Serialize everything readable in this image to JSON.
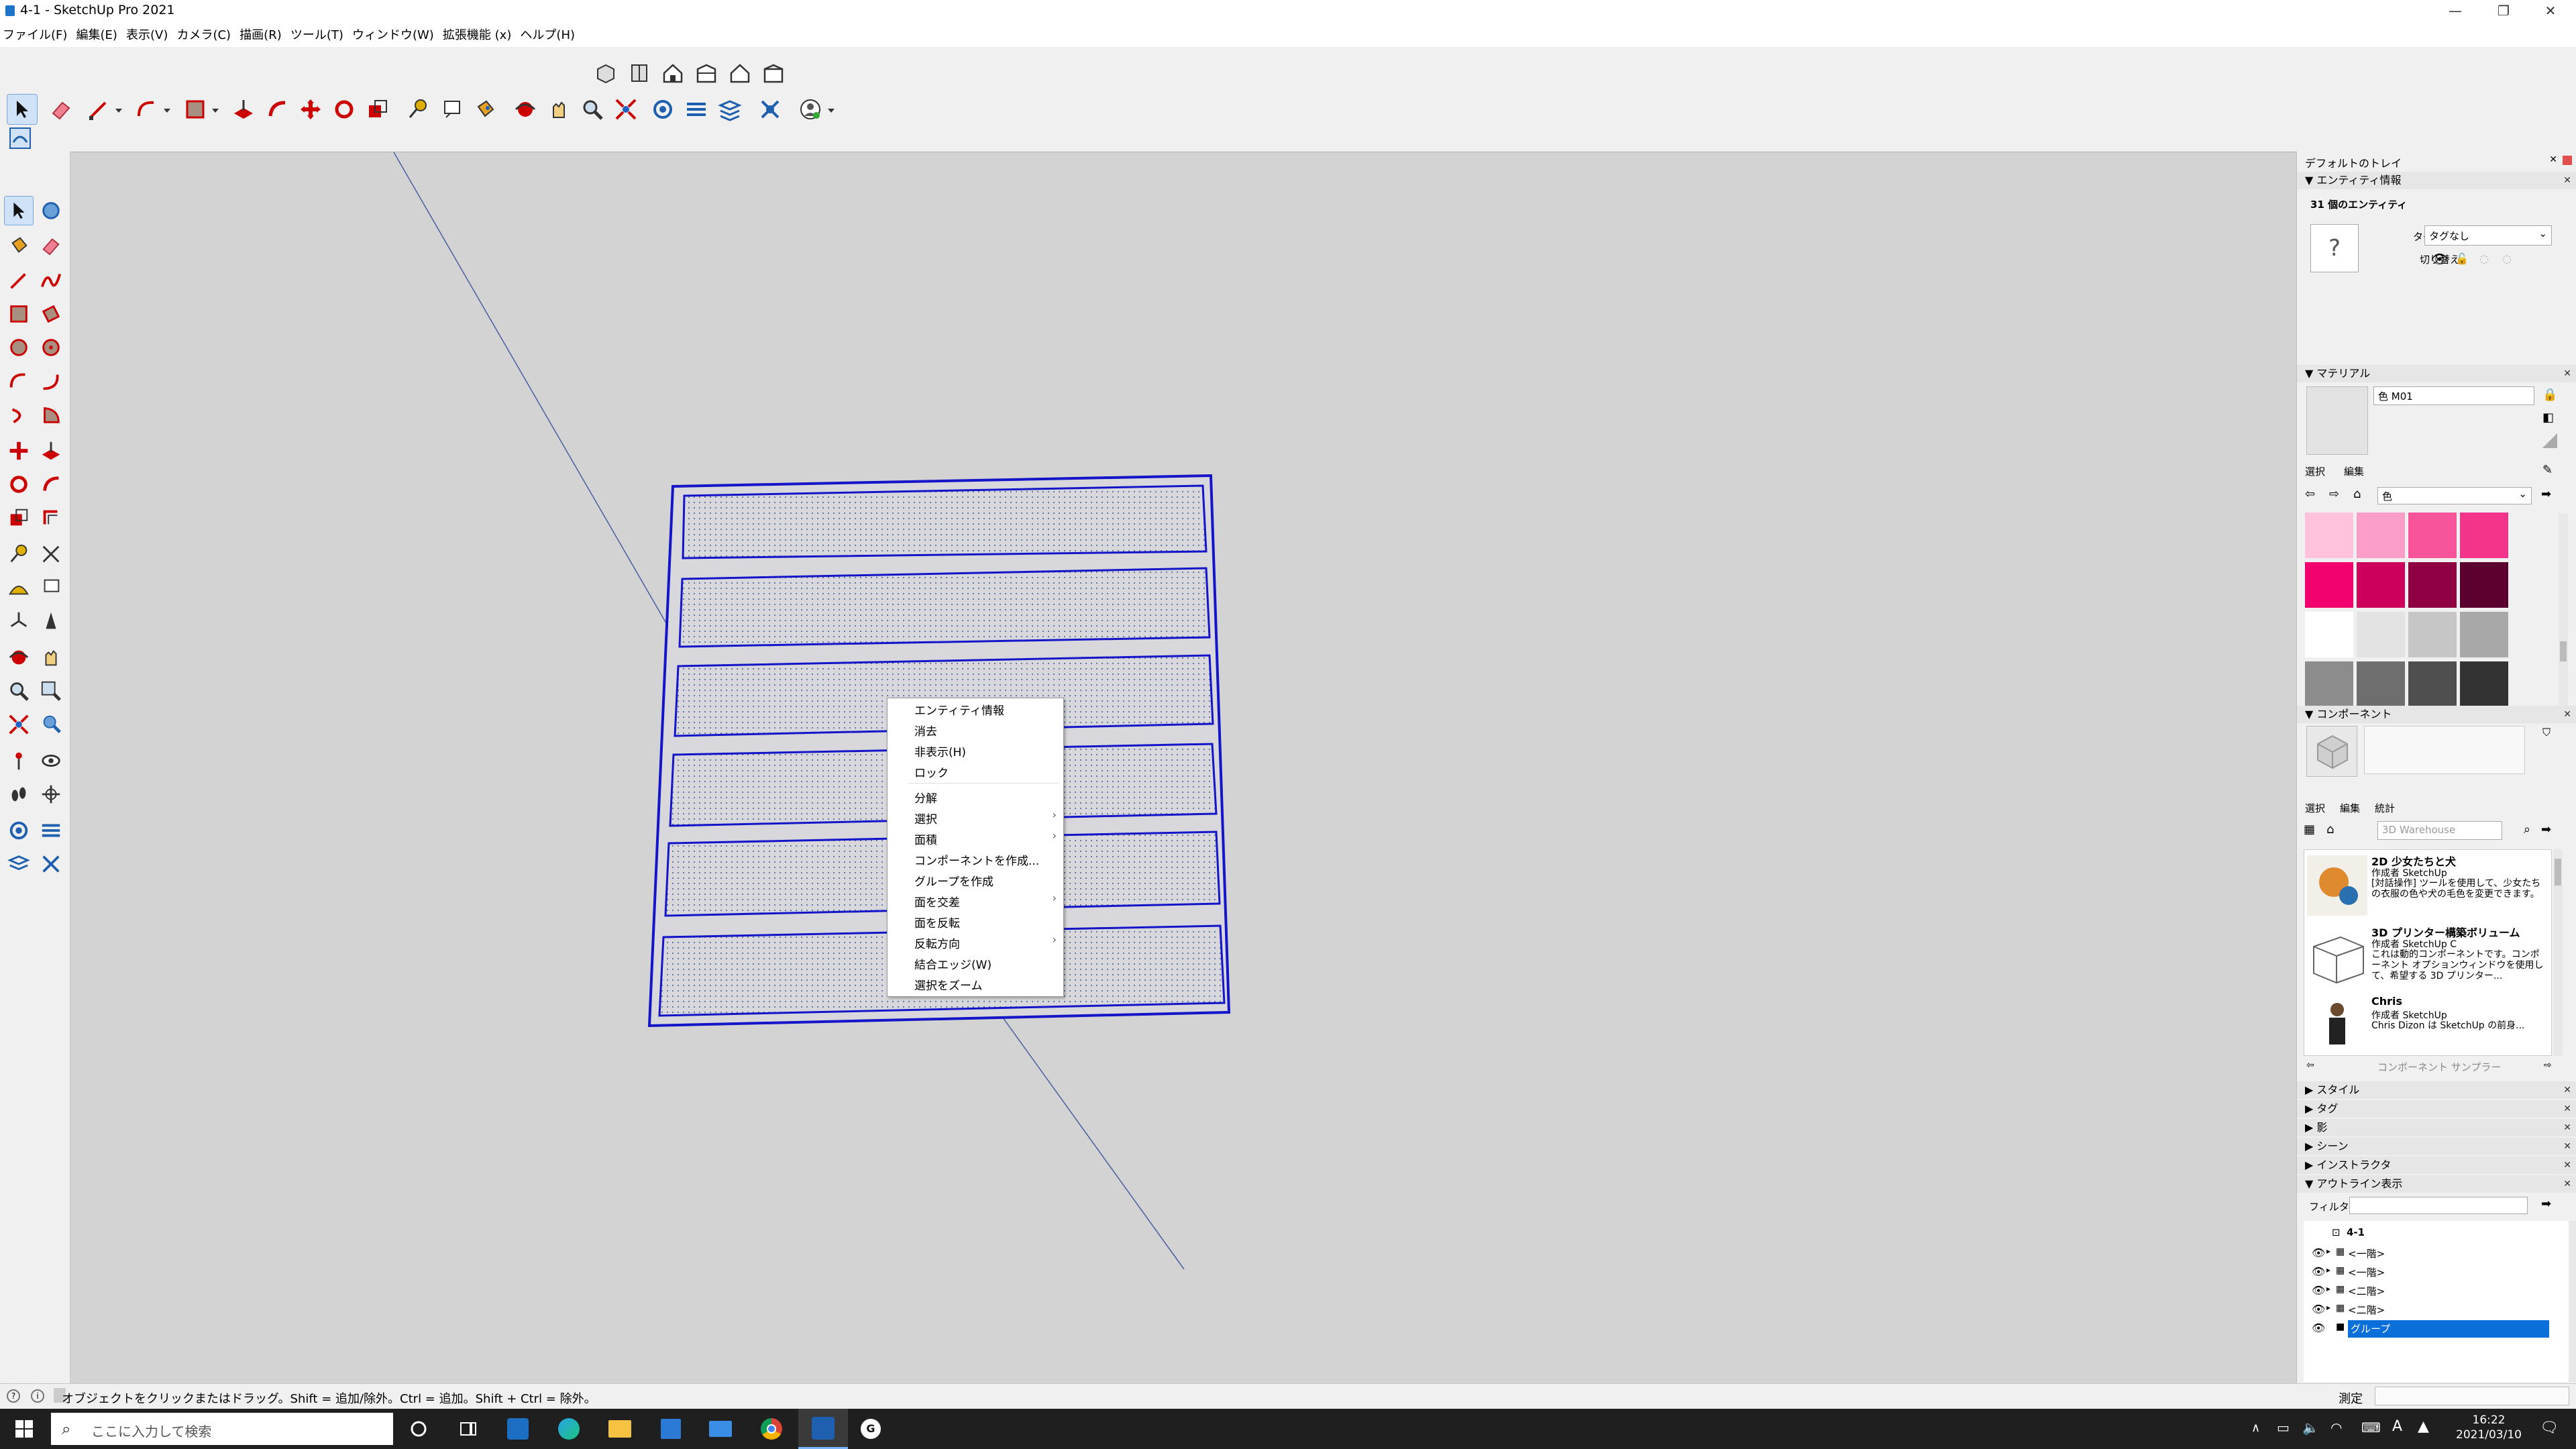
{
  "window": {
    "title": "4-1 - SketchUp Pro 2021",
    "minimize": "—",
    "restore": "❐",
    "close": "✕"
  },
  "menu": [
    "ファイル(F)",
    "編集(E)",
    "表示(V)",
    "カメラ(C)",
    "描画(R)",
    "ツール(T)",
    "ウィンドウ(W)",
    "拡張機能 (x)",
    "ヘルプ(H)"
  ],
  "context_menu": {
    "items": [
      "エンティティ情報",
      "消去",
      "非表示(H)",
      "ロック",
      "分解",
      "選択",
      "面積",
      "コンポーネントを作成...",
      "グループを作成",
      "面を交差",
      "面を反転",
      "反転方向",
      "結合エッジ(W)",
      "選択をズーム"
    ],
    "submenu_arrow": "›"
  },
  "tray": {
    "title": "デフォルトのトレイ",
    "entity_info": {
      "header": "エンティティ情報",
      "summary": "31 個のエンティティ",
      "tag_label": "タグ:",
      "tag_value": "タグなし",
      "toggle_label": "切り替え:",
      "unknown_glyph": "?"
    },
    "materials": {
      "header": "マテリアル",
      "name": "色 M01",
      "tab_select": "選択",
      "tab_edit": "編集",
      "library": "色",
      "swatches": [
        "#ffc2dc",
        "#fb9ec7",
        "#f7559b",
        "#f4338a",
        "#f2006e",
        "#cc005c",
        "#8f0043",
        "#5c0030",
        "#ffffff",
        "#e3e3e3",
        "#c6c6c6",
        "#a8a8a8",
        "#8c8c8c",
        "#6e6e6e",
        "#4f4f4f",
        "#333333"
      ]
    },
    "components": {
      "header": "コンポーネント",
      "tab_select": "選択",
      "tab_edit": "編集",
      "tab_stats": "統計",
      "search_placeholder": "3D Warehouse",
      "items": [
        {
          "title": "2D 少女たちと犬",
          "author": "作成者 SketchUp",
          "desc": "[対話操作] ツールを使用して、少女たちの衣服の色や犬の毛色を変更できます。"
        },
        {
          "title": "3D プリンター構築ボリューム",
          "author": "作成者 SketchUp C",
          "desc": "これは動的コンポーネントです。コンポーネント オプションウィンドウを使用して、希望する 3D プリンター..."
        },
        {
          "title": "Chris",
          "author": "作成者 SketchUp",
          "desc": "Chris Dizon は SketchUp の前身..."
        }
      ],
      "sampler": "コンポーネント サンプラー"
    },
    "collapsed_panels": [
      "スタイル",
      "タグ",
      "影",
      "シーン",
      "インストラクタ"
    ],
    "outliner": {
      "header": "アウトライン表示",
      "filter_label": "フィルタ:",
      "root": "4-1",
      "rows": [
        "<一階>",
        "<一階>",
        "<二階>",
        "<二階>",
        "グループ"
      ]
    }
  },
  "status": {
    "hint": "オブジェクトをクリックまたはドラッグ。Shift = 追加/除外。Ctrl = 追加。Shift + Ctrl = 除外。",
    "measure_label": "測定"
  },
  "taskbar": {
    "search_placeholder": "ここに入力して検索",
    "time": "16:22",
    "date": "2021/03/10",
    "ime": "A"
  }
}
